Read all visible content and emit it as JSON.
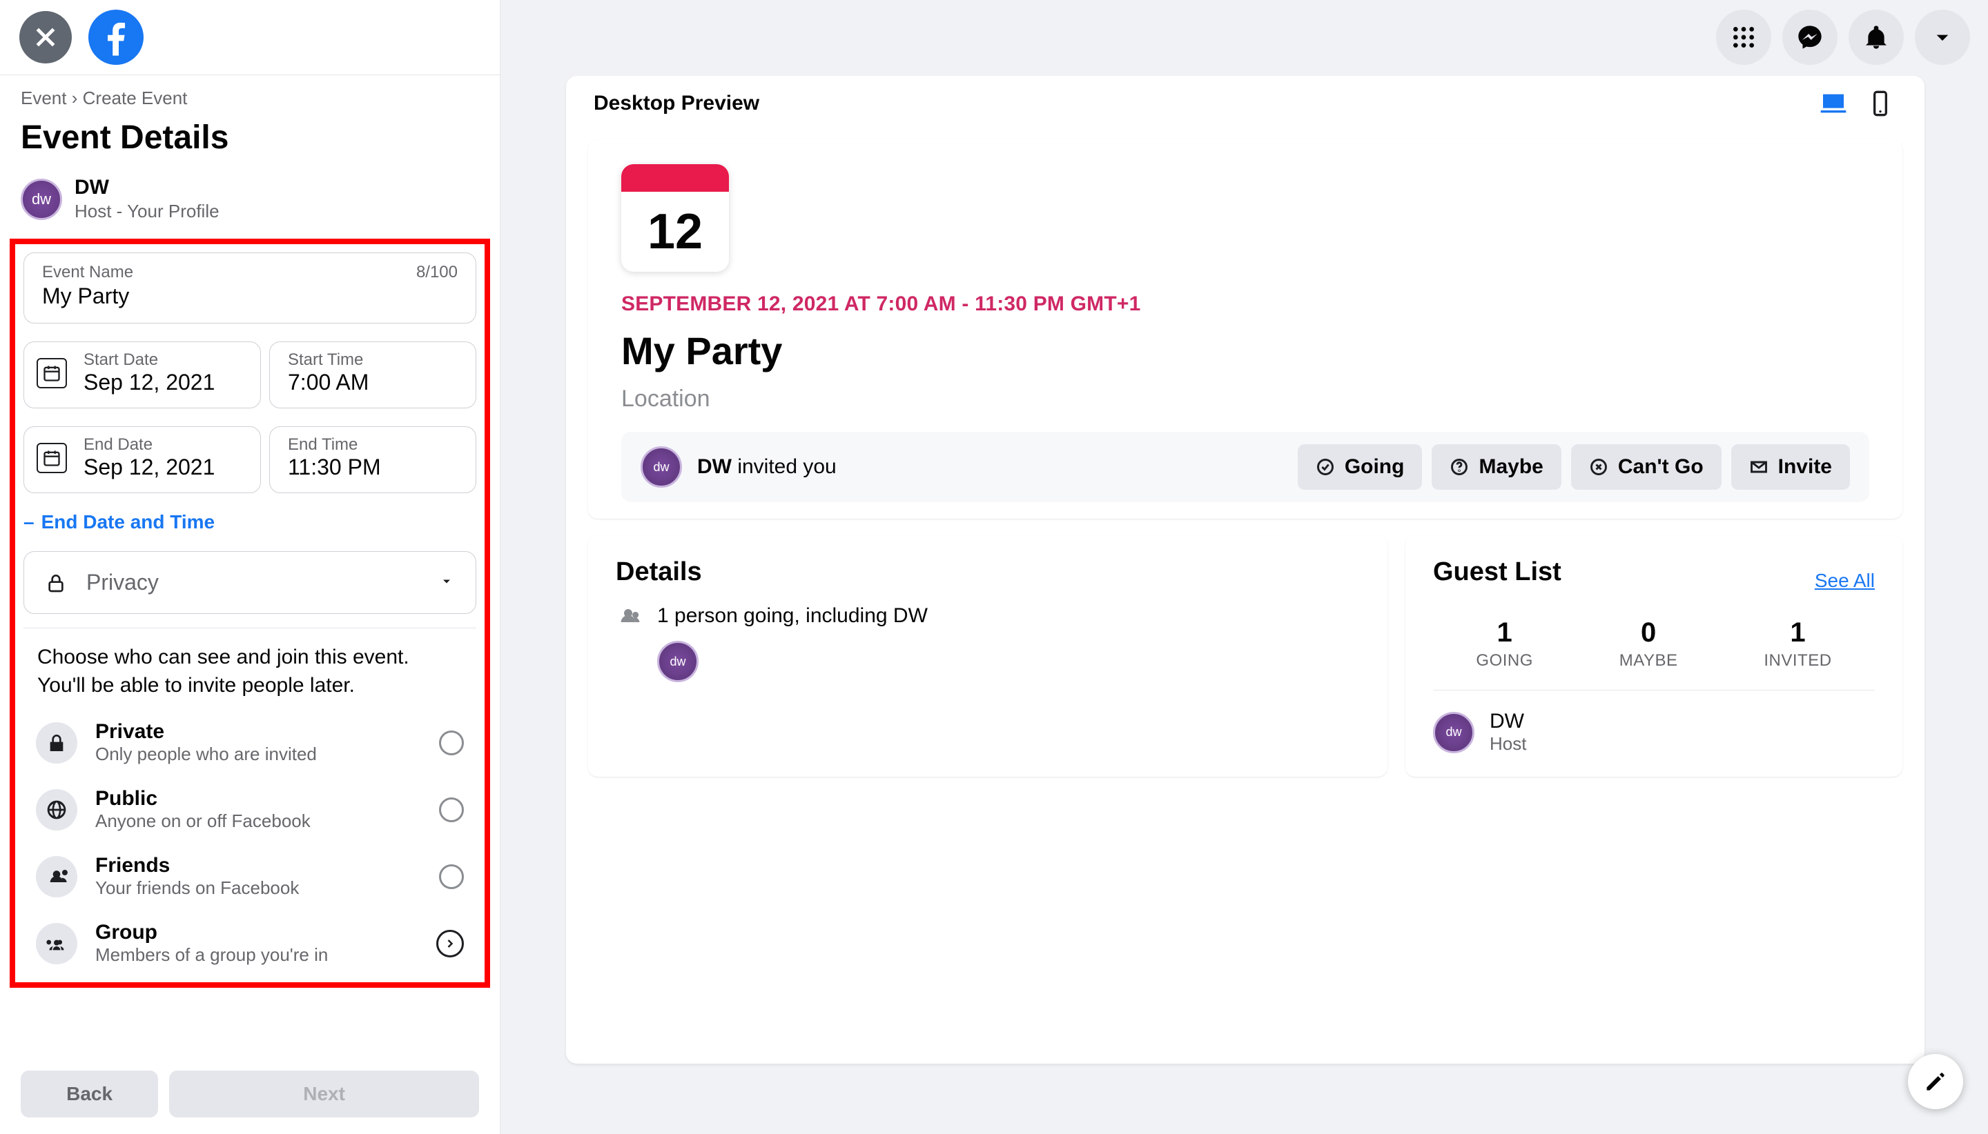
{
  "header": {
    "breadcrumb_root": "Event",
    "breadcrumb_sep": "›",
    "breadcrumb_leaf": "Create Event",
    "title": "Event Details"
  },
  "host": {
    "initials": "dw",
    "name": "DW",
    "subtitle": "Host - Your Profile"
  },
  "form": {
    "event_name_label": "Event Name",
    "event_name_value": "My Party",
    "event_name_count": "8/100",
    "start_date_label": "Start Date",
    "start_date_value": "Sep 12, 2021",
    "start_time_label": "Start Time",
    "start_time_value": "7:00 AM",
    "end_date_label": "End Date",
    "end_date_value": "Sep 12, 2021",
    "end_time_label": "End Time",
    "end_time_value": "11:30 PM",
    "end_toggle_label": "End Date and Time",
    "privacy_label": "Privacy"
  },
  "privacy_popover": {
    "description": "Choose who can see and join this event. You'll be able to invite people later.",
    "options": [
      {
        "title": "Private",
        "subtitle": "Only people who are invited",
        "icon": "lock",
        "trailing": "radio"
      },
      {
        "title": "Public",
        "subtitle": "Anyone on or off Facebook",
        "icon": "globe",
        "trailing": "radio"
      },
      {
        "title": "Friends",
        "subtitle": "Your friends on Facebook",
        "icon": "people",
        "trailing": "radio"
      },
      {
        "title": "Group",
        "subtitle": "Members of a group you're in",
        "icon": "group",
        "trailing": "chevron"
      }
    ]
  },
  "footer": {
    "back": "Back",
    "next": "Next"
  },
  "preview": {
    "label": "Desktop Preview",
    "calendar_day": "12",
    "when_line": "SEPTEMBER 12, 2021 AT 7:00 AM - 11:30 PM GMT+1",
    "event_name": "My Party",
    "location_placeholder": "Location",
    "invite_line_name": "DW",
    "invite_line_suffix": " invited you",
    "rsvp": {
      "going": "Going",
      "maybe": "Maybe",
      "cant": "Can't Go",
      "invite": "Invite"
    },
    "details_heading": "Details",
    "details_line": "1 person going, including DW",
    "guestlist_heading": "Guest List",
    "see_all": "See All",
    "counts": {
      "going_n": "1",
      "going_l": "GOING",
      "maybe_n": "0",
      "maybe_l": "MAYBE",
      "invited_n": "1",
      "invited_l": "INVITED"
    },
    "host_name": "DW",
    "host_role": "Host"
  }
}
